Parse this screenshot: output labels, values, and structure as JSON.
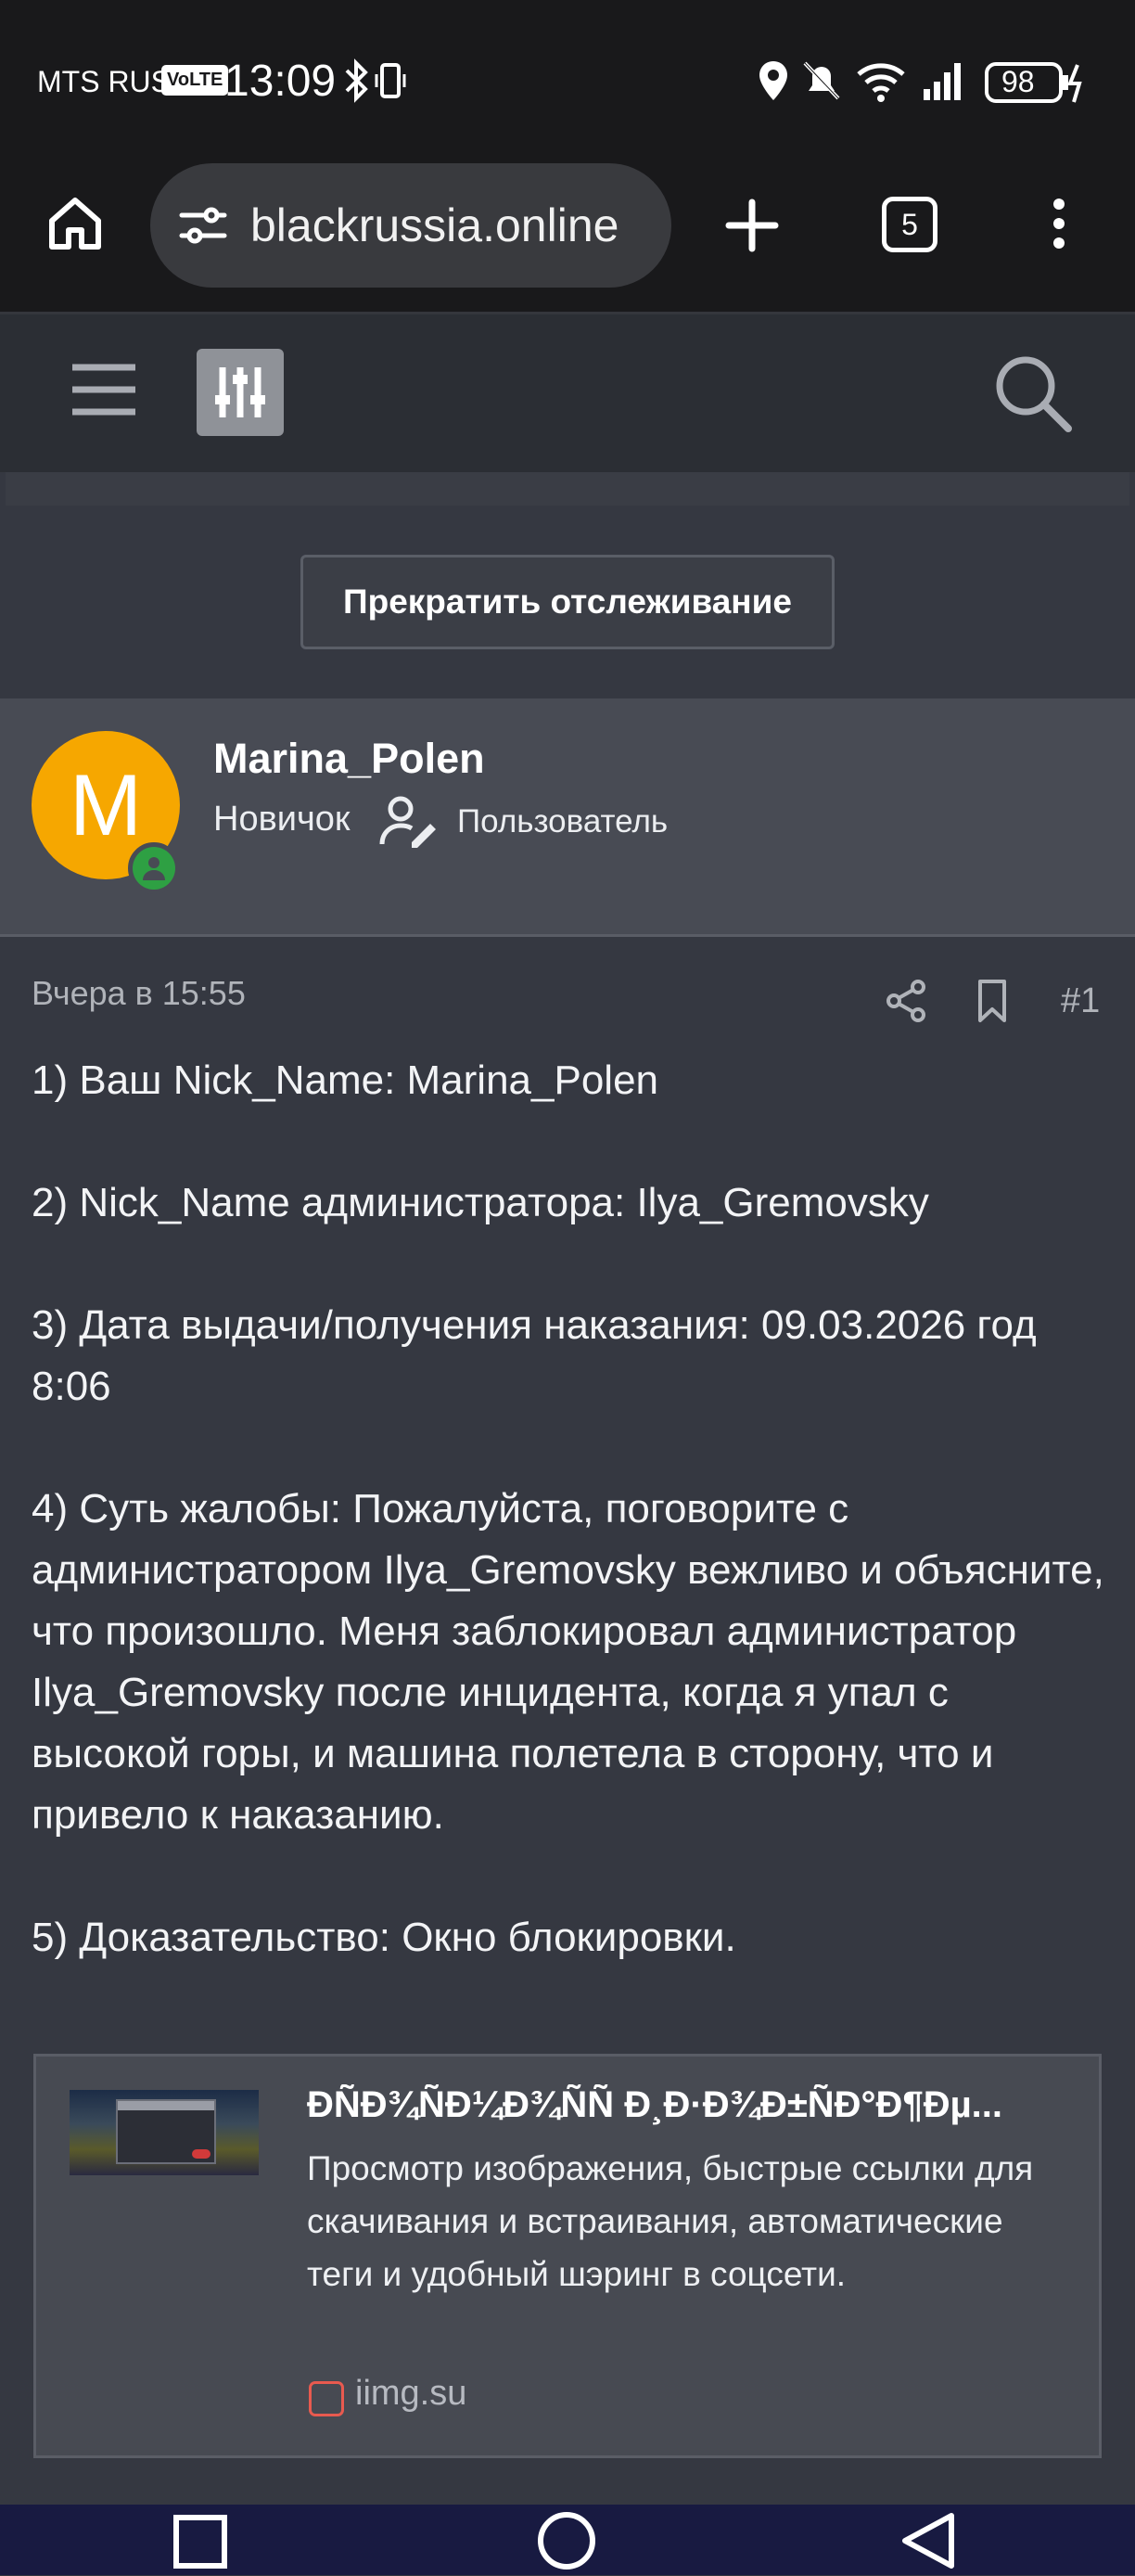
{
  "status_bar": {
    "carrier": "MTS RUS",
    "volte": "VoLTE",
    "time": "13:09",
    "battery": "98"
  },
  "browser": {
    "url": "blackrussia.online",
    "tab_count": "5"
  },
  "thread": {
    "unwatch_label": "Прекратить отслеживание"
  },
  "author": {
    "avatar_letter": "M",
    "name": "Marina_Polen",
    "rank": "Новичок",
    "role": "Пользователь",
    "online_color": "#2ea043",
    "avatar_color": "#f6a700"
  },
  "post": {
    "date": "Вчера в 15:55",
    "number": "#1",
    "lines": [
      "1) Ваш Nick_Name: Marina_Polen",
      "2) Nick_Name администратора: Ilya_Gremovsky",
      "3) Дата выдачи/получения наказания: 09.03.2026 год 8:06",
      "4) Суть жалобы: Пожалуйста, поговорите с администратором Ilya_Gremovsky вежливо и объясните, что произошло. Меня заблокировал администратор Ilya_Gremovsky после инцидента, когда я упал с высокой горы, и машина полетела в сторону, что и привело к наказанию.",
      "5) Доказательство: Окно блокировки."
    ]
  },
  "embed": {
    "title": "ÐÑÐ¾ÑÐ¼Ð¾ÑÑ Ð¸Ð·Ð¾Ð±ÑÐ°Ð¶Ðµ...",
    "description": "Просмотр изображения, быстрые ссылки для скачивания и встраивания, автоматические теги и удобный шэринг в соцсети.",
    "source": "iimg.su"
  },
  "icons": {
    "home": "home-icon",
    "site_settings": "tune-icon",
    "new_tab": "plus-icon",
    "menu": "more-vert-icon",
    "hamburger": "hamburger-icon",
    "filter": "sliders-icon",
    "search": "search-icon",
    "share": "share-icon",
    "bookmark": "bookmark-icon",
    "nav_back": "back-triangle-icon",
    "nav_home": "home-circle-icon",
    "nav_recent": "recent-square-icon"
  }
}
